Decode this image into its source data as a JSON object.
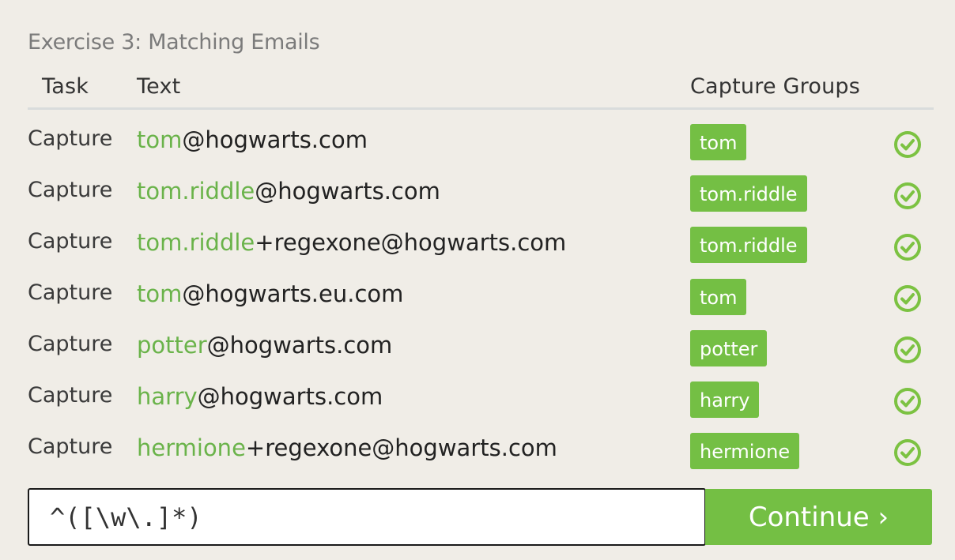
{
  "exercise": {
    "title": "Exercise 3: Matching Emails"
  },
  "table": {
    "headers": {
      "task": "Task",
      "text": "Text",
      "groups": "Capture Groups"
    },
    "rows": [
      {
        "task": "Capture",
        "match": "tom",
        "rest": "@hogwarts.com",
        "group": "tom",
        "status_icon": "check-circle-icon"
      },
      {
        "task": "Capture",
        "match": "tom.riddle",
        "rest": "@hogwarts.com",
        "group": "tom.riddle",
        "status_icon": "check-circle-icon"
      },
      {
        "task": "Capture",
        "match": "tom.riddle",
        "rest": "+regexone@hogwarts.com",
        "group": "tom.riddle",
        "status_icon": "check-circle-icon"
      },
      {
        "task": "Capture",
        "match": "tom",
        "rest": "@hogwarts.eu.com",
        "group": "tom",
        "status_icon": "check-circle-icon"
      },
      {
        "task": "Capture",
        "match": "potter",
        "rest": "@hogwarts.com",
        "group": "potter",
        "status_icon": "check-circle-icon"
      },
      {
        "task": "Capture",
        "match": "harry",
        "rest": "@hogwarts.com",
        "group": "harry",
        "status_icon": "check-circle-icon"
      },
      {
        "task": "Capture",
        "match": "hermione",
        "rest": "+regexone@hogwarts.com",
        "group": "hermione",
        "status_icon": "check-circle-icon"
      }
    ]
  },
  "input": {
    "value": "^([\\w\\.]*)"
  },
  "continue": {
    "label": "Continue ›"
  },
  "colors": {
    "accent": "#74bf44",
    "match": "#6ab34a",
    "background": "#f0ede7"
  }
}
